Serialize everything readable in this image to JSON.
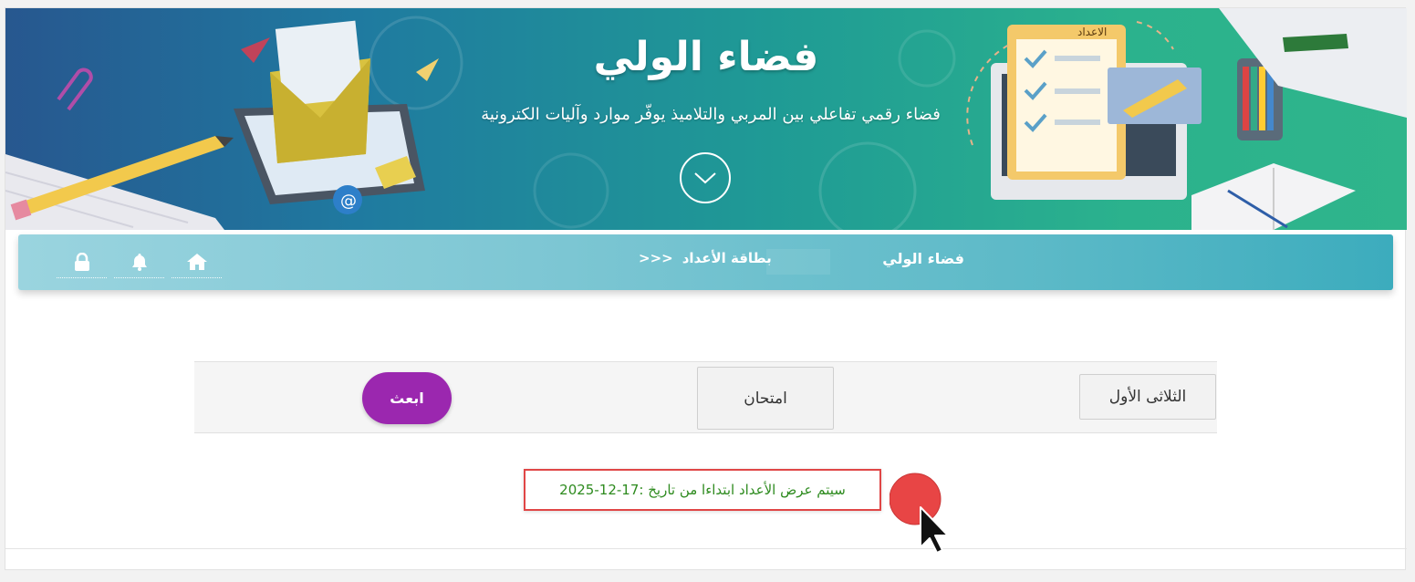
{
  "banner": {
    "title": "فضاء الولي",
    "subtitle": "فضاء رقمي تفاعلي بين المربي والتلاميذ يوفّر موارد وآليات الكترونية",
    "illustration_label": "الاعداد",
    "scroll_icon": "chevron-down-icon"
  },
  "navbar": {
    "title": "فضاء الولي",
    "breadcrumb_separator": "<<<",
    "breadcrumb_current": "بطاقة الأعداد",
    "icons": [
      "home-icon",
      "bell-icon",
      "lock-icon"
    ]
  },
  "filters": {
    "term_value": "الثلاثى الأول",
    "type_value": "امتحان",
    "send_label": "ابعث"
  },
  "notice": {
    "text": "سيتم عرض الأعداد ابتداءا من تاريخ :17-12-2025"
  },
  "colors": {
    "send_button": "#9b27af",
    "notice_border": "#e04646",
    "notice_text": "#2e8b1f",
    "navbar_start": "#9ad4df",
    "navbar_end": "#3cacbd"
  }
}
